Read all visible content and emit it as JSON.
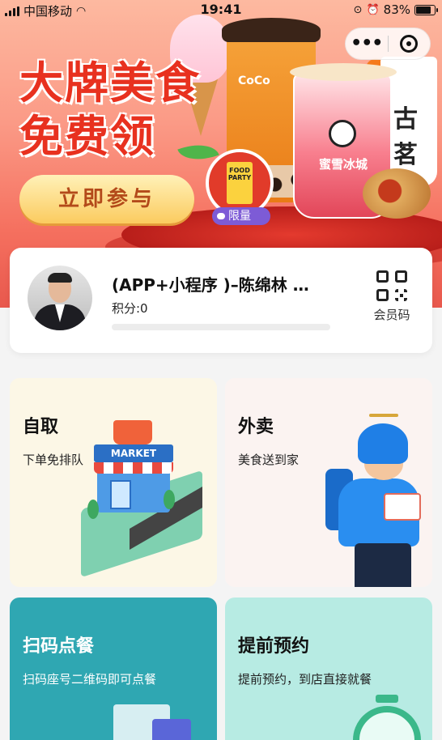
{
  "status_bar": {
    "carrier": "中国移动",
    "time": "19:41",
    "battery": "83%"
  },
  "banner": {
    "headline_line1": "大牌美食",
    "headline_line2": "免费领",
    "cta": "立即参与",
    "limited_tag": "限量",
    "cup_brand_1": "CoCo",
    "cup_brand_2": "蜜雪冰城",
    "cup_brand_3": "古茗",
    "badge_card_text": "FOOD PARTY"
  },
  "member": {
    "name": "(APP+小程序 )–陈绵林 …",
    "points_label": "积分:0",
    "points_progress": 0,
    "code_label": "会员码"
  },
  "tiles": [
    {
      "title": "自取",
      "subtitle": "下单免排队",
      "illustration_sign": "MARKET"
    },
    {
      "title": "外卖",
      "subtitle": "美食送到家"
    },
    {
      "title": "扫码点餐",
      "subtitle": "扫码座号二维码即可点餐"
    },
    {
      "title": "提前预约",
      "subtitle": "提前预约，到店直接就餐"
    }
  ],
  "colors": {
    "banner_top": "#fdb9a0",
    "banner_bottom": "#e8584d",
    "pickup_bg": "#fcf7e6",
    "delivery_bg": "#fbf3f1",
    "scan_bg": "#2fa7b2",
    "reserve_bg": "#b7ebe3"
  }
}
